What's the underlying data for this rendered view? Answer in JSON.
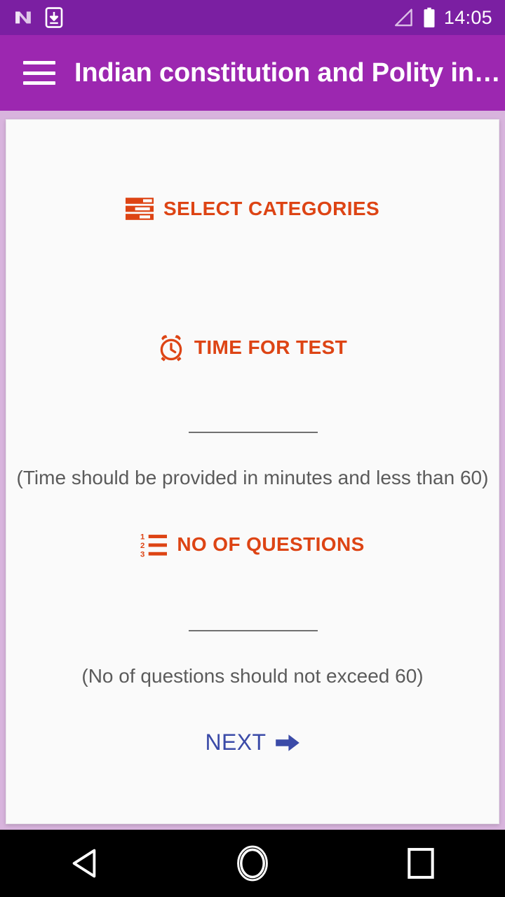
{
  "status_bar": {
    "icons": [
      "android-n-logo-icon",
      "download-to-device-icon"
    ],
    "signal_icon": "signal-triangle-icon",
    "battery_icon": "battery-full-icon",
    "time": "14:05",
    "background_color": "#7b1fa2"
  },
  "toolbar": {
    "menu_icon": "hamburger-menu-icon",
    "title": "Indian constitution and Polity in…",
    "background_color": "#9c27b0",
    "title_color": "#ffffff"
  },
  "card": {
    "background_color": "#fafafa",
    "accent_color": "#dd4414",
    "sections": {
      "categories": {
        "icon": "category-list-icon",
        "label": "SELECT CATEGORIES"
      },
      "time_for_test": {
        "icon": "alarm-clock-icon",
        "label": "TIME FOR TEST",
        "input_value": "",
        "input_placeholder": "",
        "hint": "(Time should be provided in minutes and less than 60)"
      },
      "no_of_questions": {
        "icon": "numbered-list-icon",
        "label": "NO OF QUESTIONS",
        "input_value": "",
        "input_placeholder": "",
        "hint": "(No of questions should not exceed 60)"
      }
    },
    "next": {
      "label": "NEXT",
      "icon": "arrow-right-icon",
      "color": "#3b4ba8"
    }
  },
  "nav_bar": {
    "background_color": "#000000",
    "buttons": [
      {
        "name": "back-button",
        "icon": "triangle-back-icon"
      },
      {
        "name": "home-button",
        "icon": "circle-home-icon"
      },
      {
        "name": "recents-button",
        "icon": "square-recents-icon"
      }
    ]
  }
}
